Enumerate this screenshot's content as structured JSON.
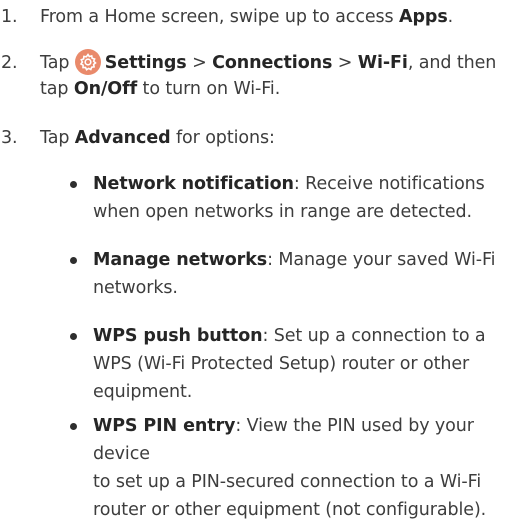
{
  "steps": [
    {
      "number": "1.",
      "pre": "From a Home screen, swipe up to access ",
      "bold": "Apps",
      "post": "."
    },
    {
      "number": "2.",
      "line1_pre": "Tap ",
      "settings": "Settings",
      "sep1": " > ",
      "connections": "Connections",
      "sep2": " > ",
      "wifi": "Wi-Fi",
      "line1_post": ", and then",
      "line2_pre": "tap ",
      "onoff": "On/Off",
      "line2_post": " to turn on Wi-Fi.",
      "icon": "settings-gear-icon",
      "icon_color": "#e98a6b"
    },
    {
      "number": "3.",
      "pre": "Tap ",
      "bold": "Advanced",
      "post": " for options:"
    }
  ],
  "bullets": [
    {
      "term": "Network notification",
      "line1": ": Receive notifications",
      "line2": "when open networks in range are detected."
    },
    {
      "term": "Manage networks",
      "line1": ": Manage your saved Wi-Fi",
      "line2": "networks."
    },
    {
      "term": "WPS push button",
      "line1": ": Set up a connection to a",
      "line2": "WPS (Wi-Fi Protected Setup) router or other",
      "line3": "equipment."
    },
    {
      "term": "WPS PIN entry",
      "line1": ": View the PIN used by your device",
      "line2": "to set up a PIN-secured connection to a Wi-Fi",
      "line3": "router or other equipment (not configurable)."
    }
  ]
}
